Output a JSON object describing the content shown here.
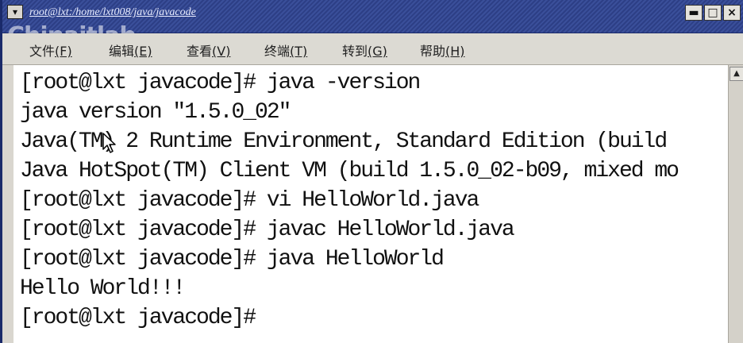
{
  "window": {
    "title": "root@lxt:/home/lxt008/java/javacode",
    "sysmenu_icon": "chevron-down-icon",
    "buttons": {
      "minimize": "▬",
      "maximize": "□",
      "close": "×"
    }
  },
  "watermark": "Chinaitlab",
  "menubar": {
    "items": [
      {
        "label": "文件",
        "accel": "(F)"
      },
      {
        "label": "编辑",
        "accel": "(E)"
      },
      {
        "label": "查看",
        "accel": "(V)"
      },
      {
        "label": "终端",
        "accel": "(T)"
      },
      {
        "label": "转到",
        "accel": "(G)"
      },
      {
        "label": "帮助",
        "accel": "(H)"
      }
    ]
  },
  "terminal": {
    "lines": [
      "[root@lxt javacode]# java -version",
      "java version \"1.5.0_02\"",
      "Java(TM) 2 Runtime Environment, Standard Edition (build",
      "Java HotSpot(TM) Client VM (build 1.5.0_02-b09, mixed mo",
      "[root@lxt javacode]# vi HelloWorld.java",
      "[root@lxt javacode]# javac HelloWorld.java",
      "[root@lxt javacode]# java HelloWorld",
      "Hello World!!!",
      "[root@lxt javacode]#"
    ]
  },
  "scrollbar": {
    "up_arrow": "▲"
  },
  "colors": {
    "titlebar": "#3a4f9a",
    "menubar": "#dcdad3",
    "terminal_bg": "#ffffff",
    "terminal_fg": "#111111"
  }
}
